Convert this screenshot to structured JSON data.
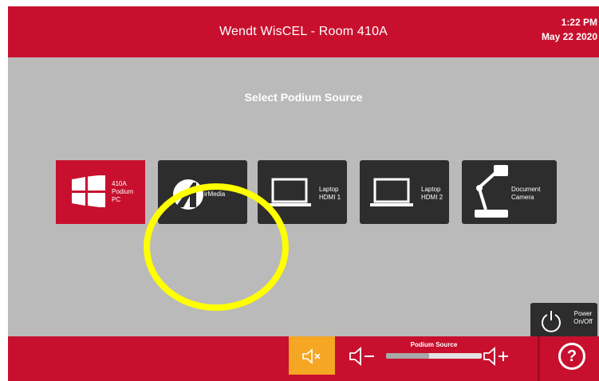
{
  "header": {
    "title": "Wendt WisCEL - Room 410A",
    "time": "1:22 PM",
    "date": "May 22 2020"
  },
  "main": {
    "heading": "Select Podium Source",
    "sources": [
      {
        "lines": [
          "410A",
          "Podium",
          "PC"
        ],
        "icon": "windows-icon",
        "selected": true
      },
      {
        "lines": [
          "irMedia"
        ],
        "icon": "airmedia-icon",
        "selected": false
      },
      {
        "lines": [
          "Laptop",
          "HDMI 1"
        ],
        "icon": "laptop-icon",
        "selected": false
      },
      {
        "lines": [
          "Laptop",
          "HDMI 2"
        ],
        "icon": "laptop-icon",
        "selected": false
      },
      {
        "lines": [
          "Document",
          "Camera"
        ],
        "icon": "document-camera-icon",
        "selected": false
      }
    ],
    "highlight_color": "#ffff00"
  },
  "power": {
    "line1": "Power",
    "line2": "On/Off",
    "icon": "power-icon"
  },
  "footer": {
    "volume_caption": "Podium Source",
    "volume_level": 0.45,
    "mute_icon": "speaker-mute-icon",
    "vol_down_icon": "speaker-minus-icon",
    "vol_up_icon": "speaker-plus-icon",
    "help_label": "?"
  },
  "colors": {
    "brand_red": "#c8102e",
    "panel_gray": "#bababa",
    "tile_dark": "#2d2d2d",
    "mute_orange": "#f5a623"
  }
}
